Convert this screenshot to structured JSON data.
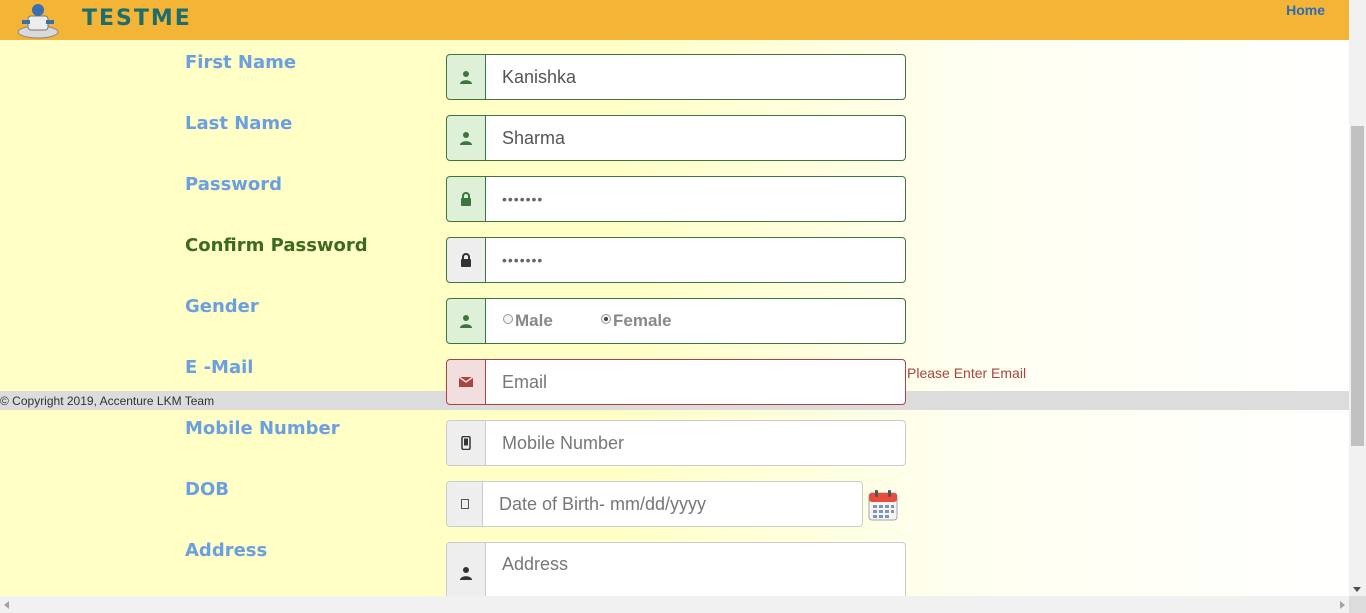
{
  "header": {
    "logo_text": "TESTME",
    "home_link": "Home",
    "background_color": "#f4b435"
  },
  "form": {
    "first_name": {
      "label": "First Name",
      "value": "Kanishka",
      "icon": "user-icon"
    },
    "last_name": {
      "label": "Last Name",
      "value": "Sharma",
      "icon": "user-icon"
    },
    "password": {
      "label": "Password",
      "value": "•••••••",
      "icon": "lock-icon"
    },
    "confirm_password": {
      "label": "Confirm Password",
      "value": "•••••••",
      "icon": "lock-icon"
    },
    "gender": {
      "label": "Gender",
      "icon": "user-icon",
      "options": [
        "Male",
        "Female"
      ],
      "selected": "Female"
    },
    "email": {
      "label": "E -Mail",
      "placeholder": "Email",
      "icon": "envelope-icon",
      "error": "Please Enter Email"
    },
    "mobile": {
      "label": "Mobile Number",
      "placeholder": "Mobile Number",
      "icon": "phone-icon"
    },
    "dob": {
      "label": "DOB",
      "placeholder": "Date of Birth- mm/dd/yyyy",
      "icon": "calendar-icon"
    },
    "address": {
      "label": "Address",
      "placeholder": "Address",
      "icon": "user-icon"
    }
  },
  "footer": {
    "text": "© Copyright 2019, Accenture LKM Team"
  },
  "colors": {
    "label_blue": "#6a9fe0",
    "success_green": "#3c763d",
    "error_red": "#a94442"
  }
}
